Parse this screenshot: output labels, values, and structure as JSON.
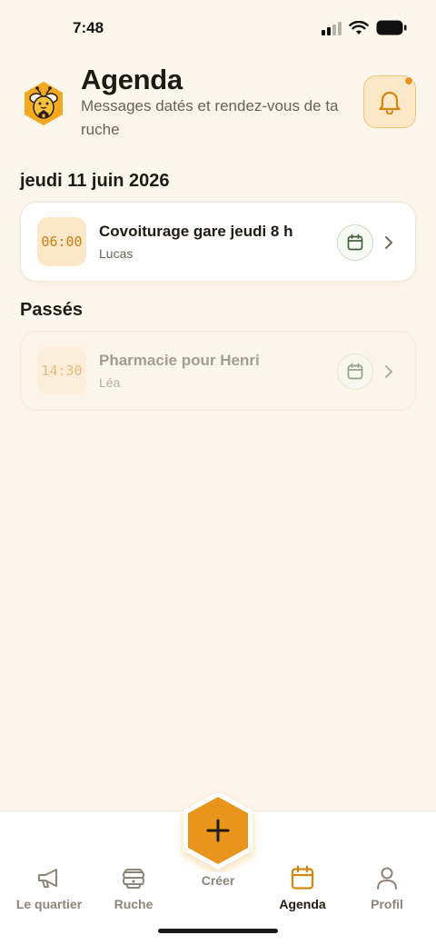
{
  "status_bar": {
    "time": "7:48"
  },
  "header": {
    "title": "Agenda",
    "subtitle": "Messages datés et rendez-vous de ta ruche",
    "logo_icon": "bee-house-logo",
    "notifications_icon": "bell-icon",
    "has_unread": true
  },
  "sections": [
    {
      "heading": "jeudi 11 juin 2026",
      "events": [
        {
          "time": "06:00",
          "title": "Covoiturage gare jeudi 8 h",
          "author": "Lucas",
          "past": false
        }
      ]
    },
    {
      "heading": "Passés",
      "events": [
        {
          "time": "14:30",
          "title": "Pharmacie pour Henri",
          "author": "Léa",
          "past": true
        }
      ]
    }
  ],
  "nav": {
    "items": [
      {
        "label": "Le quartier",
        "icon": "megaphone-icon"
      },
      {
        "label": "Ruche",
        "icon": "beehive-icon"
      },
      {
        "label": "Agenda",
        "icon": "calendar-icon",
        "active": true
      },
      {
        "label": "Profil",
        "icon": "user-icon"
      }
    ],
    "create_label": "Créer",
    "create_icon": "plus-icon"
  },
  "colors": {
    "background": "#fdf6ec",
    "accent": "#e9951d",
    "accent_soft": "#fbe8c8",
    "calendar_green": "#3f5e3a"
  }
}
